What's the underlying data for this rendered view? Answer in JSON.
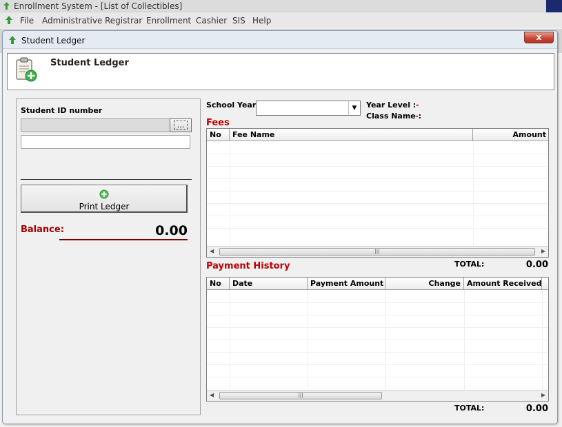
{
  "window": {
    "title": "Enrollment System - [List of Collectibles]"
  },
  "menu": [
    "File",
    "Administrative",
    "Registrar",
    "Enrollment",
    "Cashier",
    "SIS",
    "Help"
  ],
  "dialog": {
    "title": "Student Ledger",
    "close_label": "x",
    "header_title": "Student Ledger"
  },
  "student": {
    "id_label": "Student ID number",
    "id_value": "",
    "name_value": "",
    "browse_label": "..."
  },
  "print_label": "Print Ledger",
  "balance": {
    "label": "Balance:",
    "value": "0.00"
  },
  "school_year": {
    "label": "School Year",
    "value": ""
  },
  "year_level": {
    "label": "Year Level :",
    "value": "-"
  },
  "class_name": {
    "label": "Class Name :",
    "value": "-"
  },
  "fees": {
    "title": "Fees",
    "columns": [
      "No",
      "Fee Name",
      "Amount"
    ],
    "rows": [],
    "total_label": "TOTAL:",
    "total_value": "0.00"
  },
  "payment_history": {
    "title": "Payment History",
    "columns": [
      "No",
      "Date",
      "Payment Amount",
      "Change",
      "Amount Received"
    ],
    "rows": [],
    "total_label": "TOTAL:",
    "total_value": "0.00"
  },
  "colors": {
    "accent_red": "#c00000",
    "balance_line": "#7a0000",
    "titlebar_navy": "#1a2a6c"
  }
}
